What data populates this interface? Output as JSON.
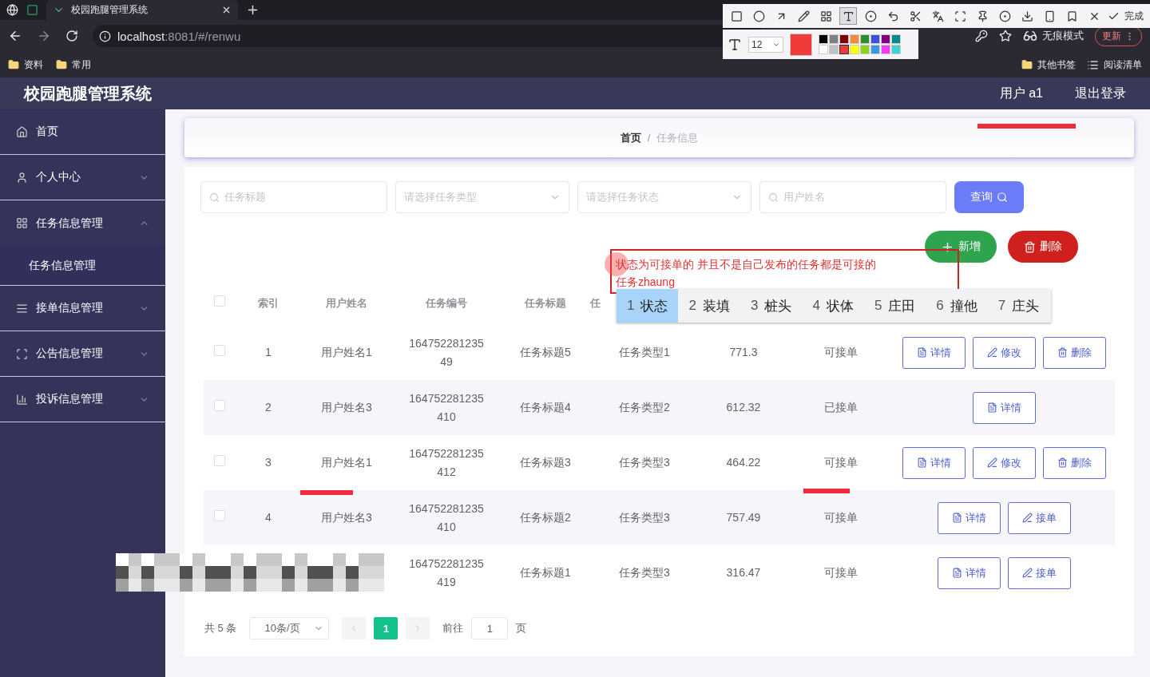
{
  "browser": {
    "tabs": [
      {
        "title": "校园跑腿管理系统",
        "selected": true
      }
    ],
    "address": {
      "host": "localhost",
      "rest": ":8081/#/renwu"
    },
    "profile": "无痕模式",
    "update": "更新",
    "bookmarks": [
      "资料",
      "常用"
    ],
    "bookmarks_right": [
      "其他书签",
      "阅读清单"
    ]
  },
  "capture_tool": {
    "tools": [
      {
        "kind": "rect",
        "selected": false
      },
      {
        "kind": "circle",
        "selected": false
      },
      {
        "kind": "arrow",
        "selected": false
      },
      {
        "kind": "pencil",
        "selected": false
      },
      {
        "kind": "mosaic",
        "selected": false
      },
      {
        "kind": "text",
        "selected": true
      },
      {
        "kind": "number",
        "selected": false
      },
      {
        "kind": "undo",
        "selected": false
      },
      {
        "kind": "cut",
        "selected": false
      },
      {
        "kind": "translate",
        "selected": false
      },
      {
        "kind": "scan",
        "selected": false
      },
      {
        "kind": "pin",
        "selected": false
      },
      {
        "kind": "record",
        "selected": false
      },
      {
        "kind": "download",
        "selected": false
      },
      {
        "kind": "phone",
        "selected": false
      },
      {
        "kind": "bookmark",
        "selected": false
      },
      {
        "kind": "close",
        "selected": false
      }
    ],
    "done": "完成",
    "font_size": "12",
    "palette": [
      {
        "color": "#000000",
        "selected": false
      },
      {
        "color": "#808080",
        "selected": false
      },
      {
        "color": "#800000",
        "selected": false
      },
      {
        "color": "#f08c3c",
        "selected": false
      },
      {
        "color": "#2e8b2e",
        "selected": false
      },
      {
        "color": "#3c50d8",
        "selected": false
      },
      {
        "color": "#800080",
        "selected": false
      },
      {
        "color": "#008b8b",
        "selected": false
      },
      {
        "color": "#ffffff",
        "selected": false
      },
      {
        "color": "#c0c0c0",
        "selected": false
      },
      {
        "color": "#f03a3a",
        "selected": true
      },
      {
        "color": "#ffff00",
        "selected": false
      },
      {
        "color": "#8ccd1e",
        "selected": false
      },
      {
        "color": "#3c96e6",
        "selected": false
      },
      {
        "color": "#f03cf0",
        "selected": false
      },
      {
        "color": "#3cd2d2",
        "selected": false
      }
    ]
  },
  "app": {
    "title": "校园跑腿管理系统",
    "user": "用户 a1",
    "logout": "退出登录"
  },
  "sidebar": {
    "items": [
      {
        "label": "首页",
        "kind": "home",
        "expanded": false
      },
      {
        "label": "个人中心",
        "kind": "user",
        "expanded": false
      },
      {
        "label": "任务信息管理",
        "kind": "grid",
        "expanded": true,
        "children": [
          {
            "label": "任务信息管理",
            "selected": true
          }
        ]
      },
      {
        "label": "接单信息管理",
        "kind": "list",
        "expanded": false
      },
      {
        "label": "公告信息管理",
        "kind": "frame",
        "expanded": false
      },
      {
        "label": "投诉信息管理",
        "kind": "bars",
        "expanded": false
      }
    ]
  },
  "breadcrumb": {
    "items": [
      "首页",
      "任务信息"
    ],
    "separator": "/"
  },
  "filters": [
    {
      "kind": "search",
      "placeholder": "任务标题"
    },
    {
      "kind": "select",
      "placeholder": "请选择任务类型"
    },
    {
      "kind": "select",
      "placeholder": "请选择任务状态"
    },
    {
      "kind": "search",
      "placeholder": "用户姓名"
    }
  ],
  "query_button": "查询",
  "add_button": "新增",
  "delete_button": "删除",
  "annotation": {
    "lines": [
      "状态为可接单的 并且不是自己发布的任务都是可接的",
      "任务zhaung"
    ]
  },
  "ime_candidates": [
    {
      "number": "1",
      "text": "状态",
      "selected": true
    },
    {
      "number": "2",
      "text": "装填",
      "selected": false
    },
    {
      "number": "3",
      "text": "桩头",
      "selected": false
    },
    {
      "number": "4",
      "text": "状体",
      "selected": false
    },
    {
      "number": "5",
      "text": "庄田",
      "selected": false
    },
    {
      "number": "6",
      "text": "撞他",
      "selected": false
    },
    {
      "number": "7",
      "text": "庄头",
      "selected": false
    }
  ],
  "table": {
    "all_checked": false,
    "columns": [
      "索引",
      "用户姓名",
      "任务编号",
      "任务标题",
      "任"
    ],
    "rows": [
      {
        "index": "1",
        "name": "用户姓名1",
        "number": "164752281235\n49",
        "title": "任务标题5",
        "type": "任务类型1",
        "price": "771.3",
        "status": "可接单",
        "checked": false,
        "actions": [
          {
            "kind": "detail",
            "label": "详情"
          },
          {
            "kind": "edit",
            "label": "修改"
          },
          {
            "kind": "delete",
            "label": "删除"
          }
        ]
      },
      {
        "index": "2",
        "name": "用户姓名3",
        "number": "164752281235\n410",
        "title": "任务标题4",
        "type": "任务类型2",
        "price": "612.32",
        "status": "已接单",
        "checked": false,
        "actions": [
          {
            "kind": "detail",
            "label": "详情"
          }
        ]
      },
      {
        "index": "3",
        "name": "用户姓名1",
        "number": "164752281235\n412",
        "title": "任务标题3",
        "type": "任务类型3",
        "price": "464.22",
        "status": "可接单",
        "checked": false,
        "actions": [
          {
            "kind": "detail",
            "label": "详情"
          },
          {
            "kind": "edit",
            "label": "修改"
          },
          {
            "kind": "delete",
            "label": "删除"
          }
        ]
      },
      {
        "index": "4",
        "name": "用户姓名3",
        "number": "164752281235\n410",
        "title": "任务标题2",
        "type": "任务类型3",
        "price": "757.49",
        "status": "可接单",
        "checked": false,
        "actions": [
          {
            "kind": "detail",
            "label": "详情"
          },
          {
            "kind": "accept",
            "label": "接单"
          }
        ]
      },
      {
        "number": "164752281235\n419",
        "title": "任务标题1",
        "type": "任务类型3",
        "price": "316.47",
        "status": "可接单",
        "actions": [
          {
            "kind": "detail",
            "label": "详情"
          },
          {
            "kind": "accept",
            "label": "接单"
          }
        ]
      }
    ]
  },
  "pagination": {
    "total": "共 5 条",
    "page_size": "10条/页",
    "pages": [
      {
        "label": "1",
        "selected": true
      }
    ],
    "goto": "前往",
    "goto_value": "1",
    "suffix": "页"
  }
}
